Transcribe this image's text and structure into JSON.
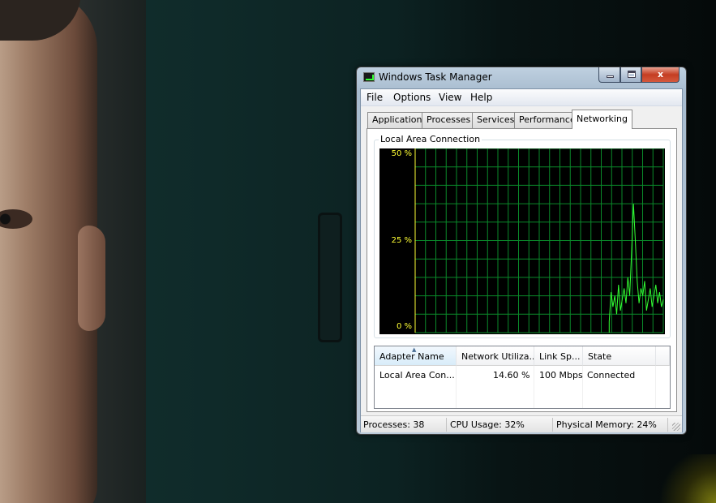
{
  "window": {
    "title": "Windows Task Manager",
    "controls": {
      "close": "x"
    }
  },
  "menu": [
    "File",
    "Options",
    "View",
    "Help"
  ],
  "tabs": [
    {
      "label": "Applications",
      "active": false
    },
    {
      "label": "Processes",
      "active": false
    },
    {
      "label": "Services",
      "active": false
    },
    {
      "label": "Performance",
      "active": false
    },
    {
      "label": "Networking",
      "active": true
    }
  ],
  "graph": {
    "title": "Local Area Connection",
    "y_labels": {
      "top": "50 %",
      "mid": "25 %",
      "bottom": "0 %"
    },
    "grid_color": "#0a8a2a",
    "line_color": "#33ff33",
    "label_color": "#ffff33"
  },
  "adapter_table": {
    "columns": [
      "Adapter Name",
      "Network Utiliza...",
      "Link Sp...",
      "State"
    ],
    "rows": [
      {
        "adapter_name": "Local Area Con...",
        "utilization": "14.60 %",
        "link_speed": "100 Mbps",
        "state": "Connected"
      }
    ]
  },
  "status": {
    "processes": "Processes: 38",
    "cpu": "CPU Usage: 32%",
    "memory": "Physical Memory: 24%"
  },
  "chart_data": {
    "type": "line",
    "ylim": [
      0,
      50
    ],
    "y_unit": "%",
    "series": [
      {
        "values": [
          3,
          11,
          7,
          10,
          5,
          13,
          6,
          9,
          12,
          8,
          15,
          10,
          22,
          35,
          25,
          14,
          8,
          12,
          10,
          14,
          6,
          9,
          12,
          7,
          10,
          13,
          8,
          11,
          7,
          9
        ]
      }
    ]
  }
}
